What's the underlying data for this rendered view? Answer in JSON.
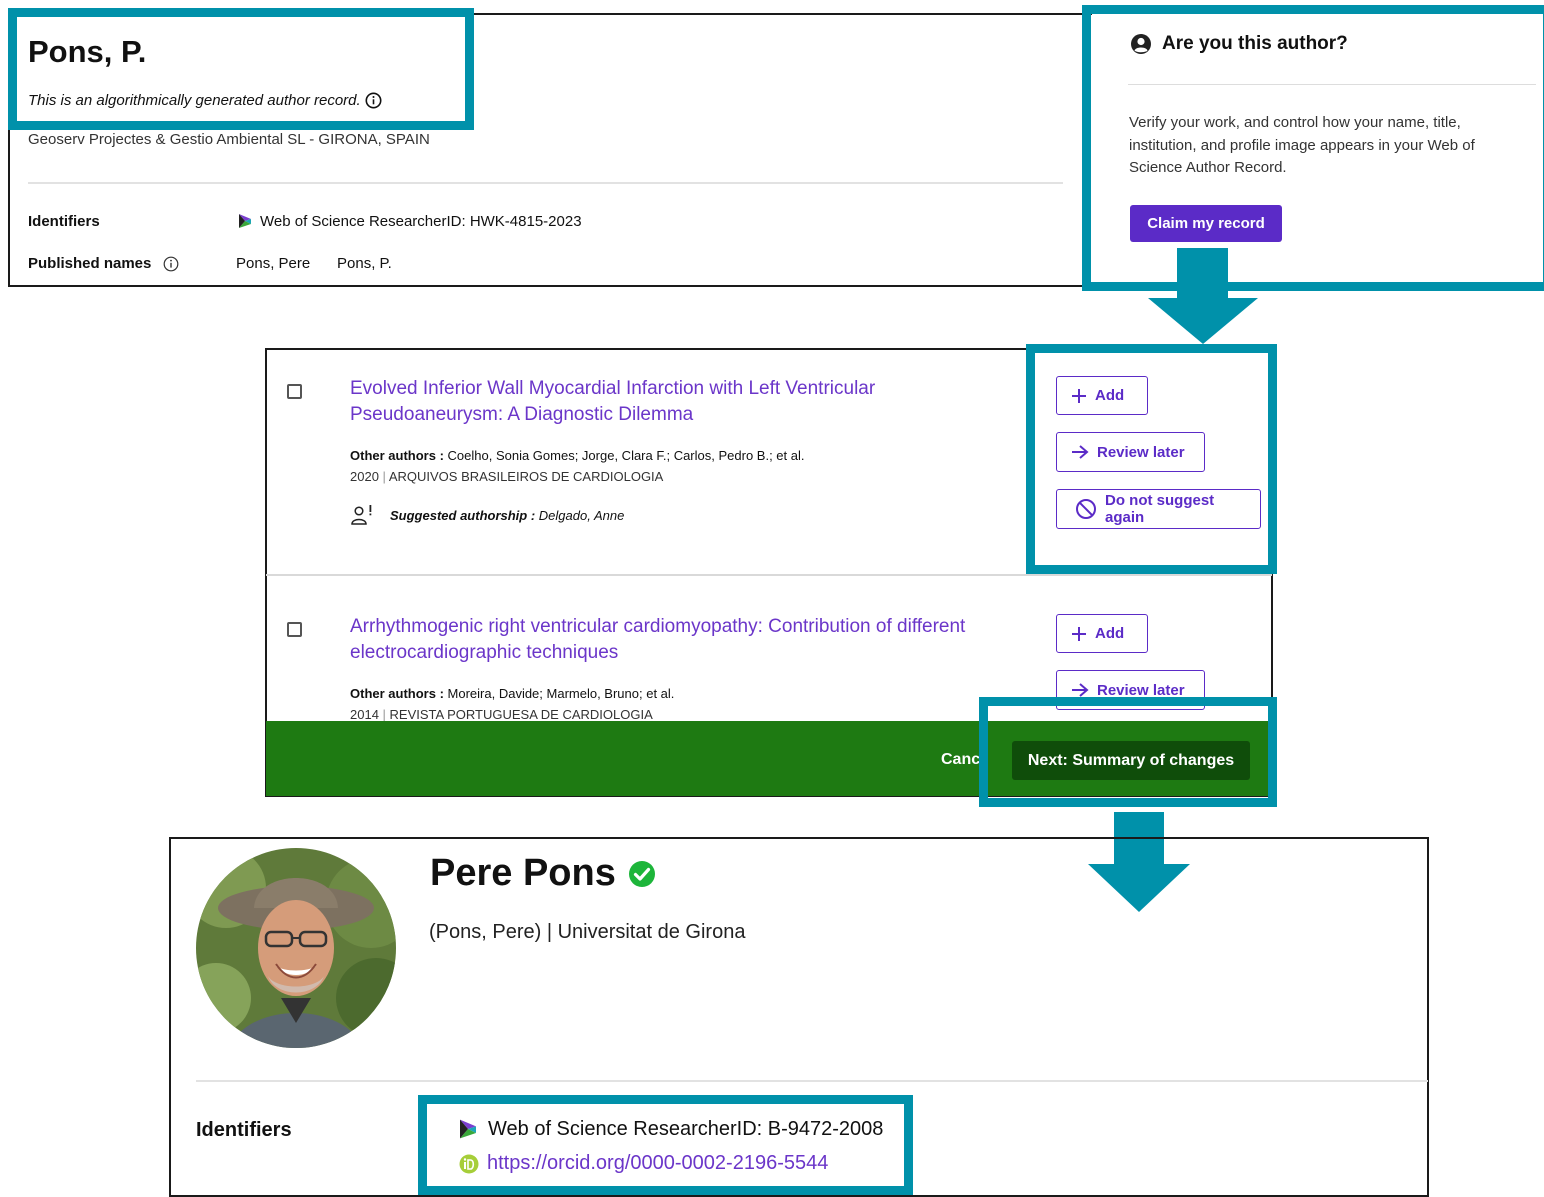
{
  "top_record": {
    "name": "Pons, P.",
    "algo_note": "This is an algorithmically generated author record.",
    "affiliation": "Geoserv Projectes & Gestio Ambiental SL - GIRONA, SPAIN",
    "identifiers_label": "Identifiers",
    "researcher_id": "Web of Science ResearcherID: HWK-4815-2023",
    "published_names_label": "Published names",
    "published_names": [
      "Pons, Pere",
      "Pons, P."
    ]
  },
  "claim_panel": {
    "title": "Are you this author?",
    "description": "Verify your work, and control how your name, title, institution, and profile image appears in your Web of Science Author Record.",
    "button": "Claim my record"
  },
  "suggestions": {
    "items": [
      {
        "title": "Evolved Inferior Wall Myocardial Infarction with Left Ventricular Pseudoaneurysm: A Diagnostic Dilemma",
        "other_authors_label": "Other authors :",
        "other_authors": "Coelho, Sonia Gomes; Jorge, Clara F.; Carlos, Pedro B.; et al.",
        "year": "2020",
        "journal": "ARQUIVOS BRASILEIROS DE CARDIOLOGIA",
        "suggested_label": "Suggested authorship :",
        "suggested_name": "Delgado, Anne"
      },
      {
        "title": "Arrhythmogenic right ventricular cardiomyopathy: Contribution of different electrocardiographic techniques",
        "other_authors_label": "Other authors :",
        "other_authors": "Moreira, Davide; Marmelo, Bruno; et al.",
        "year": "2014",
        "journal": "REVISTA PORTUGUESA DE CARDIOLOGIA"
      }
    ],
    "add_label": "Add",
    "review_later_label": "Review later",
    "do_not_suggest_label": "Do not suggest again",
    "cancel_label": "Canc",
    "next_label": "Next: Summary of changes"
  },
  "final_profile": {
    "name": "Pere Pons",
    "subtitle": "(Pons, Pere) | Universitat de Girona",
    "identifiers_label": "Identifiers",
    "researcher_id": "Web of Science ResearcherID: B-9472-2008",
    "orcid": "https://orcid.org/0000-0002-2196-5544"
  },
  "colors": {
    "highlight": "#0091aa",
    "accent_purple": "#5b2bc7",
    "footer_green": "#1e7a12",
    "next_button": "#0f4d0a",
    "verified_green": "#1db53a",
    "orcid_green": "#a6ce39"
  }
}
